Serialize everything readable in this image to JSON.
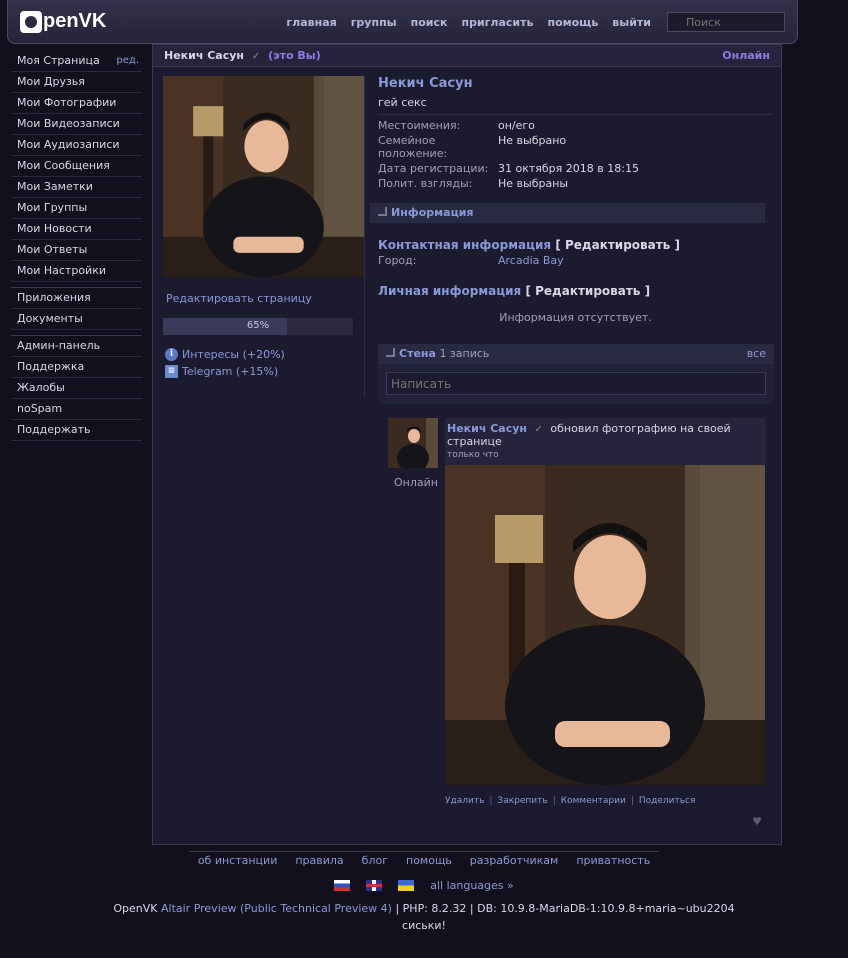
{
  "header": {
    "logo": "penVK",
    "nav": [
      "главная",
      "группы",
      "поиск",
      "пригласить",
      "помощь",
      "выйти"
    ],
    "search_placeholder": "Поиск"
  },
  "sidebar": {
    "items": [
      {
        "label": "Моя Страница",
        "edit": "ред."
      },
      {
        "label": "Мои Друзья"
      },
      {
        "label": "Мои Фотографии"
      },
      {
        "label": "Мои Видеозаписи"
      },
      {
        "label": "Мои Аудиозаписи"
      },
      {
        "label": "Мои Сообщения"
      },
      {
        "label": "Мои Заметки"
      },
      {
        "label": "Мои Группы"
      },
      {
        "label": "Мои Новости"
      },
      {
        "label": "Мои Ответы"
      },
      {
        "label": "Мои Настройки"
      }
    ],
    "apps": [
      {
        "label": "Приложения"
      },
      {
        "label": "Документы"
      }
    ],
    "admin": [
      {
        "label": "Админ-панель"
      },
      {
        "label": "Поддержка"
      },
      {
        "label": "Жалобы"
      },
      {
        "label": "noSpam"
      },
      {
        "label": "Поддержать"
      }
    ]
  },
  "profile": {
    "name": "Некич Сасун",
    "you": "(это Вы)",
    "online": "Онлайн",
    "status": "гей секс",
    "edit_page": "Редактировать страницу",
    "completion": "65%",
    "completion_value": 0.65,
    "hints": [
      {
        "label": "Интересы (+20%)"
      },
      {
        "label": "Telegram (+15%)"
      }
    ],
    "info": [
      {
        "label": "Местоимения:",
        "value": "он/его"
      },
      {
        "label": "Семейное положение:",
        "value": "Не выбрано"
      },
      {
        "label": "Дата регистрации:",
        "value": "31 октября 2018 в 18:15"
      },
      {
        "label": "Полит. взгляды:",
        "value": "Не выбраны"
      }
    ],
    "section_info": "Информация",
    "contact_title": "Контактная информация",
    "edit": "[ Редактировать ]",
    "city_label": "Город:",
    "city": "Arcadia Bay",
    "personal_title": "Личная информация",
    "no_info": "Информация отсутствует."
  },
  "wall": {
    "title": "Стена",
    "count": "1 запись",
    "all": "все",
    "placeholder": "Написать",
    "post": {
      "author": "Некич Сасун",
      "action": "обновил фотографию на своей странице",
      "time": "только что",
      "online": "Онлайн",
      "actions": [
        "Удалить",
        "Закрепить",
        "Комментарии",
        "Поделиться"
      ]
    }
  },
  "footer": {
    "links": [
      "об инстанции",
      "правила",
      "блог",
      "помощь",
      "разработчикам",
      "приватность"
    ],
    "all_languages": "all languages »",
    "version_prefix": "OpenVK",
    "version_link": "Altair Preview (Public Technical Preview 4)",
    "version_suffix": "| PHP: 8.2.32 | DB: 10.9.8-MariaDB-1:10.9.8+maria~ubu2204",
    "fun": "сиськи!"
  }
}
